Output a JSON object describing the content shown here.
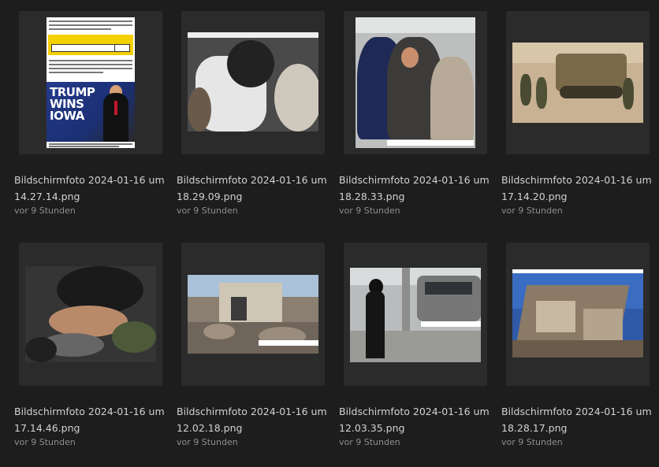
{
  "items": [
    {
      "name": "Bildschirmfoto 2024-01-16 um 14.27.14.png",
      "time": "vor 9 Stunden",
      "headline": "TRUMP WINS IOWA"
    },
    {
      "name": "Bildschirmfoto 2024-01-16 um 18.29.09.png",
      "time": "vor 9 Stunden"
    },
    {
      "name": "Bildschirmfoto 2024-01-16 um 18.28.33.png",
      "time": "vor 9 Stunden"
    },
    {
      "name": "Bildschirmfoto 2024-01-16 um 17.14.20.png",
      "time": "vor 9 Stunden"
    },
    {
      "name": "Bildschirmfoto 2024-01-16 um 17.14.46.png",
      "time": "vor 9 Stunden"
    },
    {
      "name": "Bildschirmfoto 2024-01-16 um 12.02.18.png",
      "time": "vor 9 Stunden"
    },
    {
      "name": "Bildschirmfoto 2024-01-16 um 12.03.35.png",
      "time": "vor 9 Stunden"
    },
    {
      "name": "Bildschirmfoto 2024-01-16 um 18.28.17.png",
      "time": "vor 9 Stunden"
    }
  ]
}
